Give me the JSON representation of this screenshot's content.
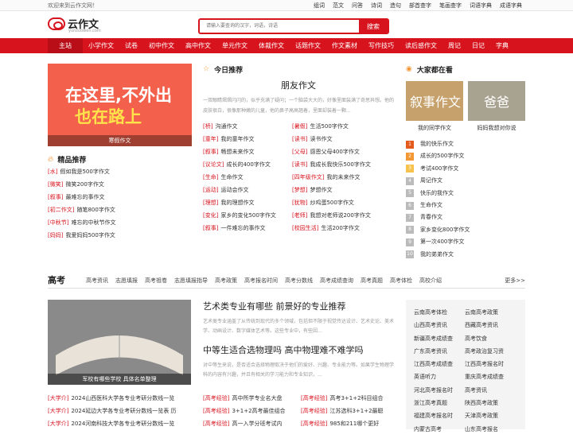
{
  "topbar": {
    "welcome": "欢迎来到云作文网！",
    "links": [
      "组词",
      "范文",
      "问答",
      "诗词",
      "造句",
      "部首查字",
      "笔画查字",
      "词语字典",
      "成语字典"
    ]
  },
  "header": {
    "logo_name": "云作文",
    "logo_sub": "yunzuowen.com",
    "search_placeholder": "请输入要查询的汉字，词语，诗语",
    "search_button": "搜索"
  },
  "nav": [
    "主站",
    "小学作文",
    "试卷",
    "初中作文",
    "高中作文",
    "单元作文",
    "体裁作文",
    "话题作文",
    "作文素材",
    "写作技巧",
    "读后感作文",
    "周记",
    "日记",
    "字典"
  ],
  "banner": {
    "line1": "在这里,不外出",
    "line2": "也在路上",
    "caption": "寒假作文"
  },
  "featured": {
    "title": "精品推荐",
    "items": [
      {
        "tag": "[水]",
        "text": "假如我是500字作文"
      },
      {
        "tag": "[微笑]",
        "text": "微笑200字作文"
      },
      {
        "tag": "[叙事]",
        "text": "最难忘的事作文"
      },
      {
        "tag": "[初二作文]",
        "text": "随笔800字作文"
      },
      {
        "tag": "[中秋节]",
        "text": "难忘的中秋节作文"
      },
      {
        "tag": "[妈妈]",
        "text": "我爱妈妈500字作文"
      }
    ]
  },
  "today": {
    "title": "今日推荐",
    "headline": "朋友作文",
    "desc": "一双眼睛熠熠闪闪的，似乎充满了疑问；一个脑袋大大的，好像里面装满了奇思异想。他的皮肤很白，很像那种嫩的儿童，他的鼻子高高翘着，里面却装着一颗...",
    "left": [
      {
        "tag": "[桥]",
        "text": "沟通作文"
      },
      {
        "tag": "[童年]",
        "text": "我的童年作文"
      },
      {
        "tag": "[叙事]",
        "text": "畅想未来作文"
      },
      {
        "tag": "[议论文]",
        "text": "成长的400字作文"
      },
      {
        "tag": "[生命]",
        "text": "生命作文"
      },
      {
        "tag": "[运动]",
        "text": "运动会作文"
      },
      {
        "tag": "[理想]",
        "text": "我的理想作文"
      },
      {
        "tag": "[变化]",
        "text": "家乡的变化500字作文"
      },
      {
        "tag": "[叙事]",
        "text": "一件难忘的事作文"
      }
    ],
    "right": [
      {
        "tag": "[暑假]",
        "text": "生活500字作文"
      },
      {
        "tag": "[读书]",
        "text": "读书作文"
      },
      {
        "tag": "[父母]",
        "text": "感恩父母400字作文"
      },
      {
        "tag": "[读书]",
        "text": "我成长我快乐500字作文"
      },
      {
        "tag": "[四年级作文]",
        "text": "我的未来作文"
      },
      {
        "tag": "[梦想]",
        "text": "梦想作文"
      },
      {
        "tag": "[犹物]",
        "text": "炒鸡蛋500字作文"
      },
      {
        "tag": "[老师]",
        "text": "我想对老师说200字作文"
      },
      {
        "tag": "[校园生活]",
        "text": "生活200字作文"
      }
    ]
  },
  "popular": {
    "title": "大家都在看",
    "thumbs": [
      {
        "big": "叙事作文",
        "caption": "我的同学作文"
      },
      {
        "big": "爸爸",
        "caption": "妈妈我想对你说"
      }
    ],
    "ranks": [
      "我的快乐作文",
      "成长的500字作文",
      "考试400字作文",
      "周记作文",
      "快乐的我作文",
      "生命作文",
      "青春作文",
      "家乡变化800字作文",
      "第一次400字作文",
      "我的弟弟作文"
    ]
  },
  "gaokao": {
    "title": "高考",
    "tabs": [
      "高考资讯",
      "志愿填报",
      "高考祖卷",
      "志愿填报指导",
      "高考政策",
      "高考报名时间",
      "高考分数线",
      "高考成绩查询",
      "高考真题",
      "高考体检",
      "高校介绍"
    ],
    "more": "更多>>",
    "image_caption": "军校有哪些学校 具体名单整理",
    "articles": [
      {
        "title": "艺术类专业有哪些 前景好的专业推荐",
        "desc": "艺术类专业涵盖了从传统到现代的多个领域，包括但不限于视觉传达设计、艺术史论、美术学、动画设计、数字媒体艺术等。这些专业中，有些因..."
      },
      {
        "title": "中等生适合选物理吗 高中物理难不难学吗",
        "desc": "对中等生来说，是否适合选择物理取决于他们的爱好、兴趣、专业能力等。如果学生物理学科的内容有兴趣，并且有相关的学习能力和专业知识，..."
      }
    ],
    "bottom_left": [
      {
        "tag": "[大学介]",
        "text": "2024山西医科大学各专业考研分数线一览"
      },
      {
        "tag": "[大学介]",
        "text": "2024延边大学各专业考研分数线一览表 历"
      },
      {
        "tag": "[大学介]",
        "text": "2024河南科技大学各专业考研分数线一览"
      }
    ],
    "bottom_mid": [
      {
        "tag": "[高考经验]",
        "text": "高中所学专业名大盘"
      },
      {
        "tag": "[高考经验]",
        "text": "3+1+2高考最佳组合"
      },
      {
        "tag": "[高考经验]",
        "text": "高一入学分班考试内"
      }
    ],
    "bottom_right": [
      {
        "tag": "[高考经验]",
        "text": "高考3+1+2科目组合"
      },
      {
        "tag": "[高考经验]",
        "text": "江苏选科3+1+2最聪"
      },
      {
        "tag": "[高考经验]",
        "text": "985和211哪个更好"
      }
    ],
    "side": [
      "云南高考体检",
      "云南高考政策",
      "山西高考资讯",
      "西藏高考资讯",
      "新疆高考成绩查",
      "高考饮食",
      "广东高考资讯",
      "高考政治复习资",
      "江西高考成绩查",
      "江西高考报名时",
      "英语听力",
      "重庆高考成绩查",
      "河北高考报名时",
      "高考资讯",
      "浙江高考真题",
      "陕西高考政策",
      "福建高考报名时",
      "天津高考政策",
      "内蒙古高考",
      "山东高考报名"
    ]
  },
  "colors": {
    "brand": "#d7141e",
    "tag": "#d7141e"
  }
}
